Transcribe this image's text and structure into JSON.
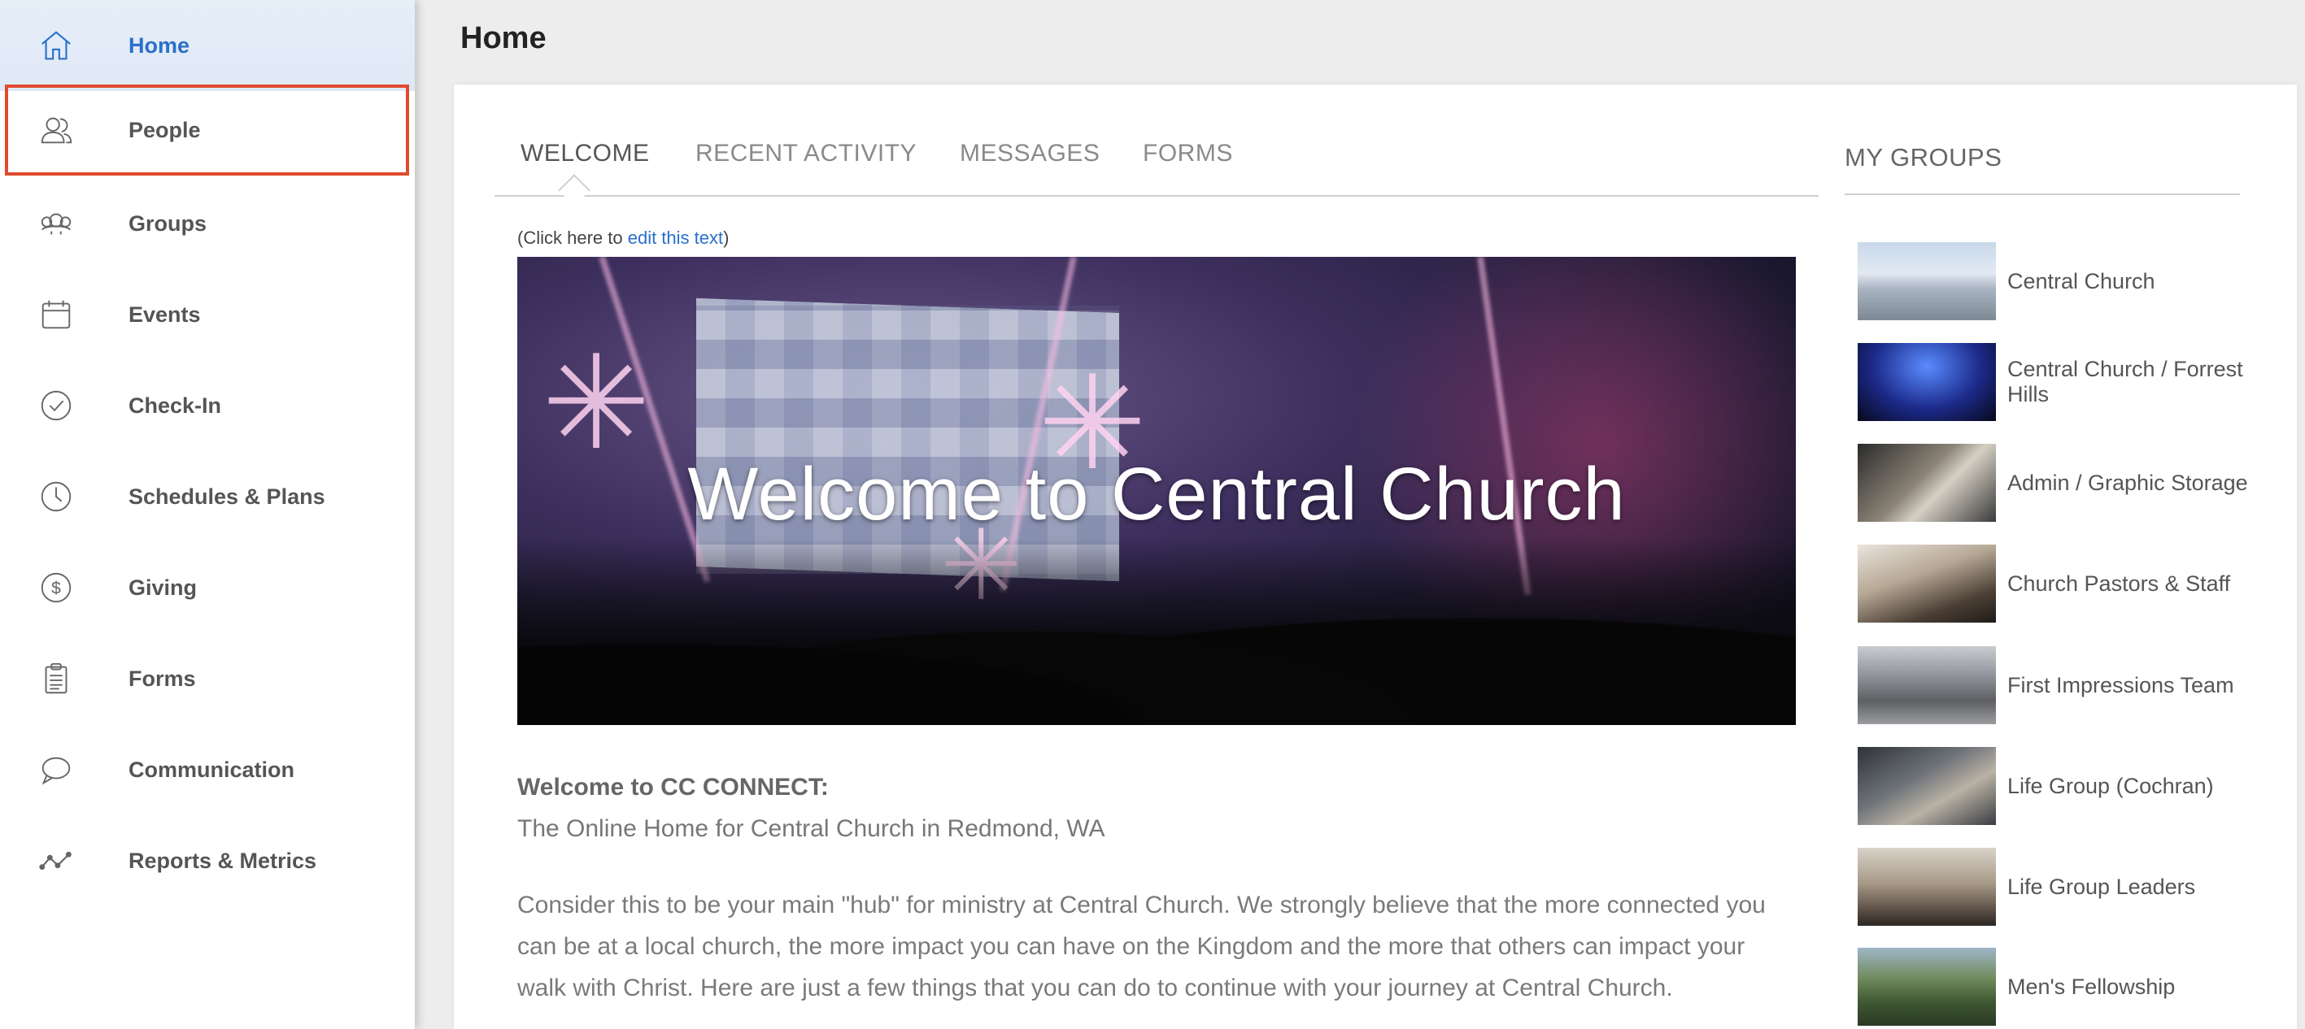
{
  "sidebar": {
    "items": [
      {
        "label": "Home",
        "icon": "home-icon"
      },
      {
        "label": "People",
        "icon": "people-icon"
      },
      {
        "label": "Groups",
        "icon": "groups-icon"
      },
      {
        "label": "Events",
        "icon": "calendar-icon"
      },
      {
        "label": "Check-In",
        "icon": "check-circle-icon"
      },
      {
        "label": "Schedules & Plans",
        "icon": "clock-icon"
      },
      {
        "label": "Giving",
        "icon": "dollar-icon"
      },
      {
        "label": "Forms",
        "icon": "clipboard-icon"
      },
      {
        "label": "Communication",
        "icon": "chat-icon"
      },
      {
        "label": "Reports & Metrics",
        "icon": "line-graph-icon"
      }
    ],
    "active": "Home",
    "highlighted": "People"
  },
  "header": {
    "title": "Home"
  },
  "tabs": [
    {
      "label": "WELCOME"
    },
    {
      "label": "RECENT ACTIVITY"
    },
    {
      "label": "MESSAGES"
    },
    {
      "label": "FORMS"
    }
  ],
  "edit_note": {
    "prefix": "(Click here to ",
    "link": "edit this text",
    "suffix": ")"
  },
  "banner": {
    "title": "Welcome to Central Church"
  },
  "welcome": {
    "heading": "Welcome to CC CONNECT:",
    "subheading": "The Online Home for Central Church in Redmond, WA",
    "body": "Consider this to be your main \"hub\" for ministry at Central Church. We strongly believe that the more connected you can be at a local church, the more impact you can have on the Kingdom and the more that others can impact your walk with Christ. Here are just a few things that you can do to continue with your journey at Central Church."
  },
  "my_groups": {
    "title": "MY GROUPS",
    "groups": [
      {
        "name": "Central Church"
      },
      {
        "name": "Central Church / Forrest Hills"
      },
      {
        "name": "Admin / Graphic Storage"
      },
      {
        "name": "Church Pastors & Staff"
      },
      {
        "name": "First Impressions Team"
      },
      {
        "name": "Life Group (Cochran)"
      },
      {
        "name": "Life Group Leaders"
      },
      {
        "name": "Men's Fellowship"
      }
    ]
  },
  "colors": {
    "accent": "#2a6fcb",
    "highlight_border": "#e04a2e"
  }
}
